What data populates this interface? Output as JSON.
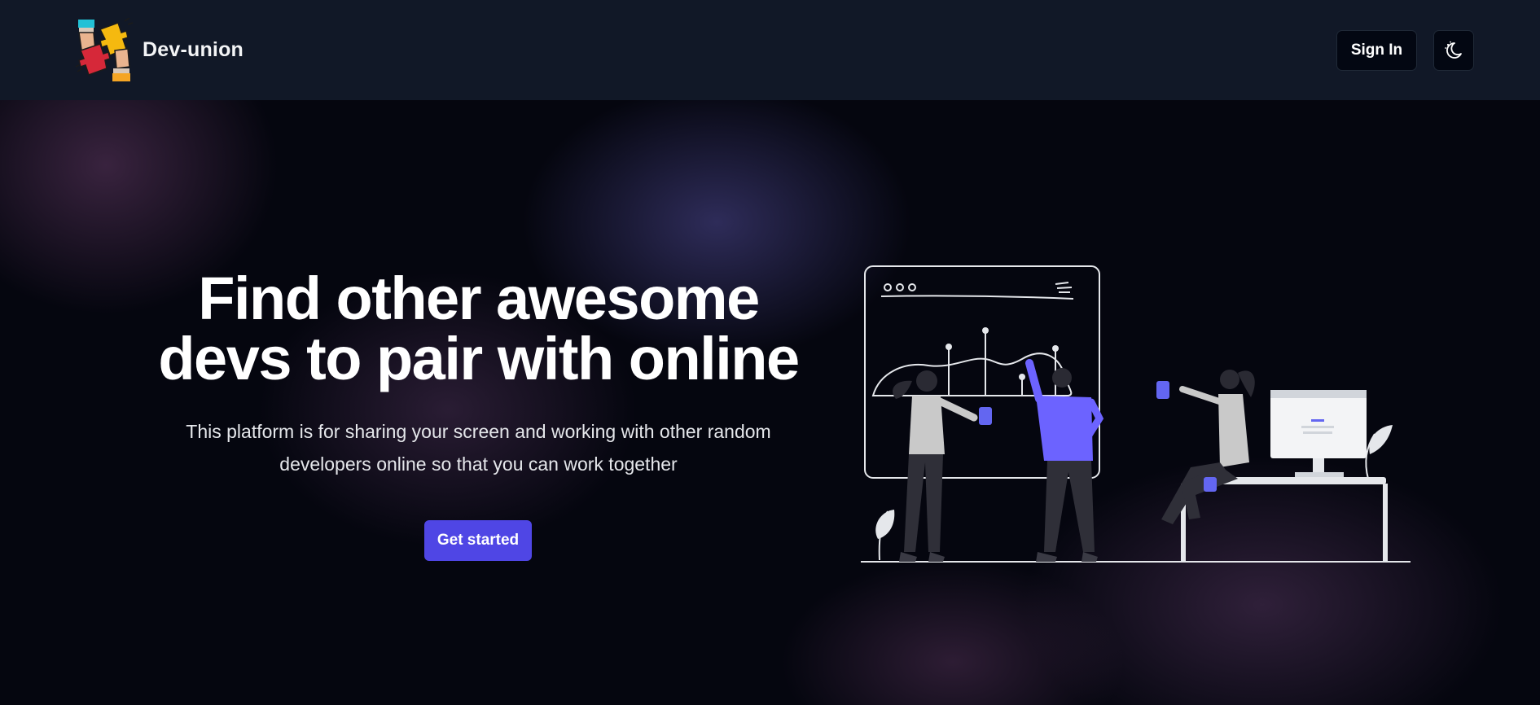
{
  "header": {
    "brand_name": "Dev-union",
    "sign_in_label": "Sign In",
    "theme_toggle_icon": "moon-stars-icon"
  },
  "hero": {
    "headline_line1": "Find other awesome",
    "headline_line2": "devs to pair with online",
    "subtext_line1": "This platform is for sharing your screen and working with other random",
    "subtext_line2": "developers online so that you can work together",
    "cta_label": "Get started"
  },
  "colors": {
    "header_bg": "#111827",
    "page_bg": "#05060f",
    "accent": "#4f46e5"
  }
}
